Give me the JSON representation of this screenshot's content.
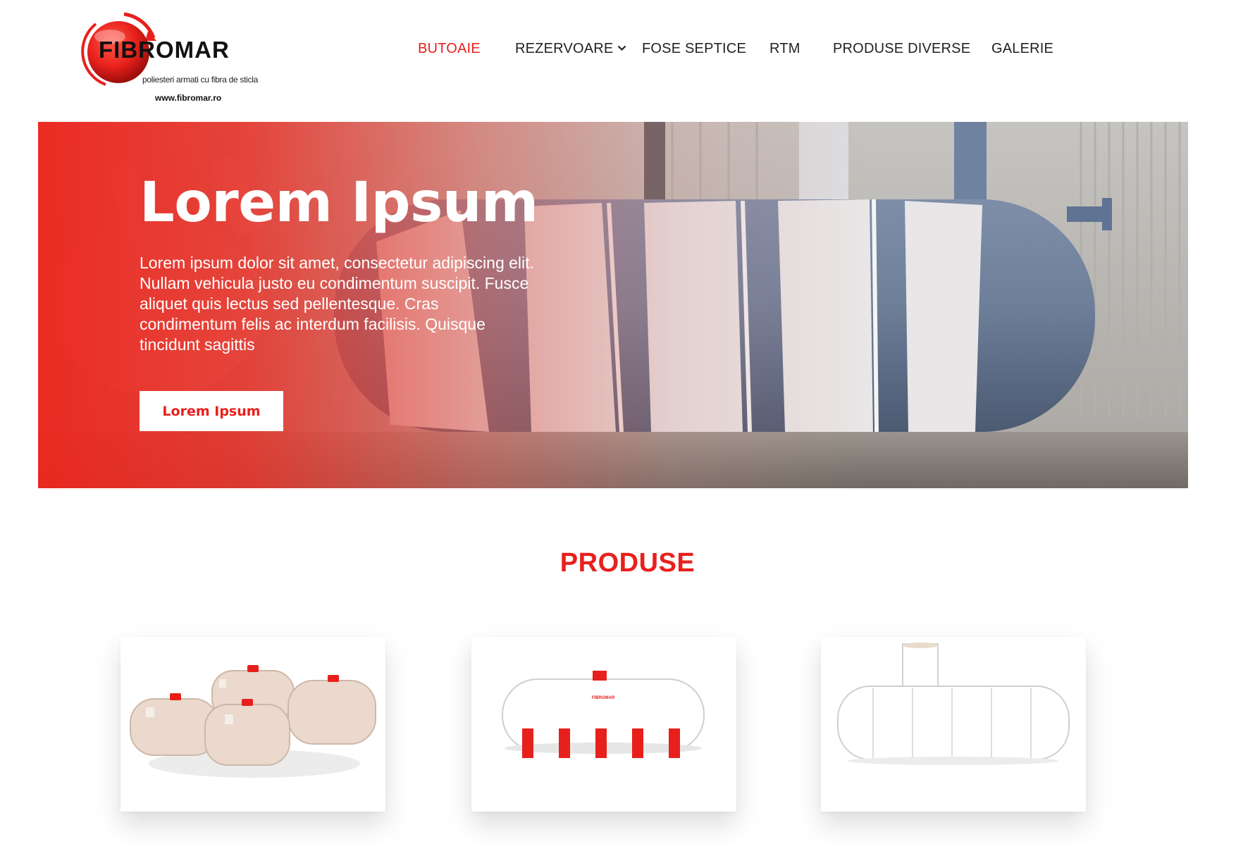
{
  "brand": {
    "name": "FIBROMAR",
    "tagline": "poliesteri armati cu fibra de sticla",
    "url": "www.fibromar.ro",
    "color": "#e8201c"
  },
  "nav": {
    "items": [
      {
        "label": "BUTOAIE",
        "active": true
      },
      {
        "label": "REZERVOARE",
        "has_dropdown": true
      },
      {
        "label": "FOSE SEPTICE"
      },
      {
        "label": "RTM"
      },
      {
        "label": "PRODUSE DIVERSE"
      },
      {
        "label": "GALERIE"
      }
    ],
    "dropdown_icon": "chevron-down-icon"
  },
  "hero": {
    "title": "Lorem Ipsum",
    "text": "Lorem ipsum dolor sit amet, consectetur adipiscing elit. Nullam vehicula justo eu condimentum suscipit. Fusce aliquet quis lectus sed pellentesque. Cras condimentum felis ac interdum facilisis. Quisque tincidunt sagittis",
    "button_label": "Lorem Ipsum",
    "gradient_color": "#ec261e"
  },
  "products": {
    "title": "PRODUSE",
    "items": [
      {
        "image": "group-of-plastic-barrels-image"
      },
      {
        "image": "white-horizontal-tank-on-red-supports-image",
        "label": "FIBROMAR"
      },
      {
        "image": "white-underground-tank-with-access-shaft-image"
      }
    ]
  },
  "colors": {
    "accent": "#e8201c",
    "text": "#222222",
    "background": "#ffffff"
  }
}
